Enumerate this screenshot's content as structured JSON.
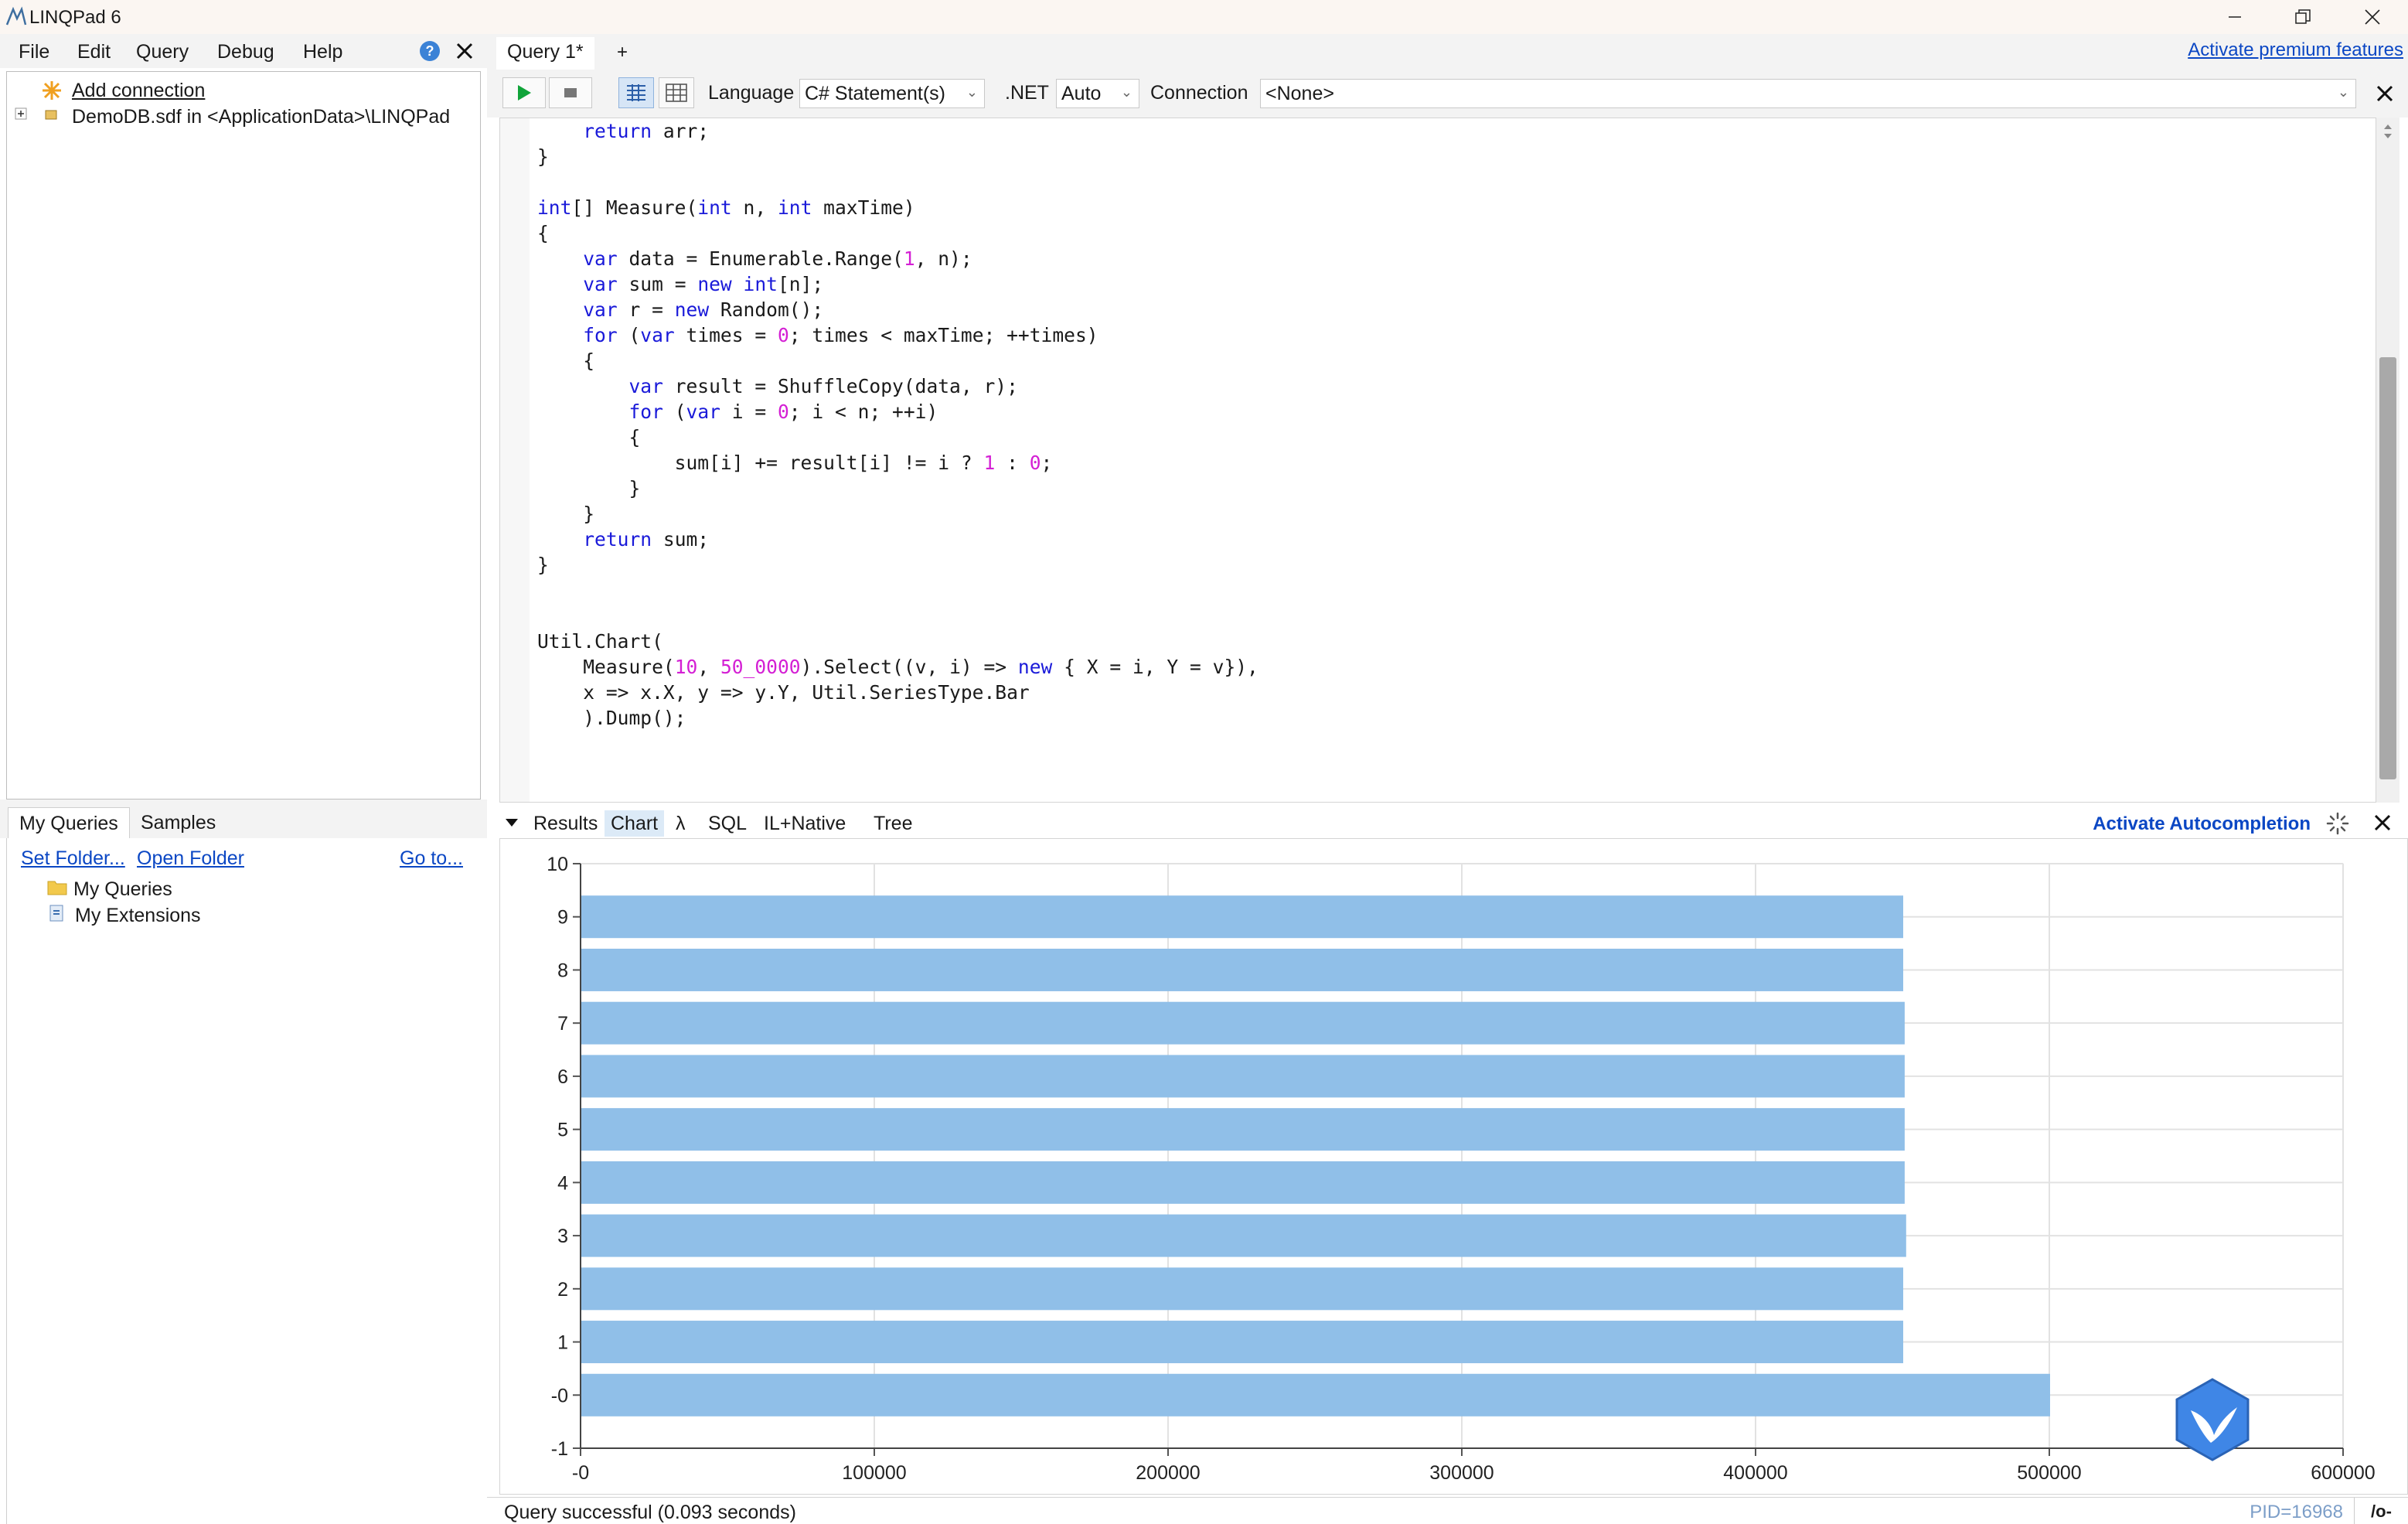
{
  "window": {
    "title": "LINQPad 6",
    "controls": [
      "minimize",
      "restore",
      "close"
    ]
  },
  "menu": {
    "items": [
      "File",
      "Edit",
      "Query",
      "Debug",
      "Help"
    ]
  },
  "connections": {
    "add_connection": "Add connection",
    "items": [
      "DemoDB.sdf in <ApplicationData>\\LINQPad"
    ]
  },
  "queries_panel": {
    "tabs": [
      "My Queries",
      "Samples"
    ],
    "set_folder": "Set Folder...",
    "open_folder": "Open Folder",
    "go_to": "Go to...",
    "tree": [
      "My Queries",
      "My Extensions"
    ]
  },
  "query_tabs": {
    "active": "Query 1*",
    "add": "+",
    "premium_link": "Activate premium features"
  },
  "toolbar": {
    "language_label": "Language",
    "language_value": "C# Statement(s)",
    "net_label": ".NET",
    "net_value": "Auto",
    "connection_label": "Connection",
    "connection_value": "<None>"
  },
  "results_bar": {
    "tabs": [
      "Results",
      "Chart",
      "λ",
      "SQL",
      "IL+Native",
      "Tree"
    ],
    "active_tab": "Chart",
    "autocompletion_link": "Activate Autocompletion"
  },
  "status": {
    "message": "Query successful  (0.093 seconds)",
    "pid": "PID=16968",
    "box": "/o-"
  },
  "colors": {
    "bar": "#90bfe8",
    "link": "#0b47c4",
    "keyword": "#1a1ad9",
    "number": "#d41fd4"
  },
  "chart_data": {
    "type": "bar",
    "orientation": "horizontal",
    "categories": [
      "-0",
      "1",
      "2",
      "3",
      "4",
      "5",
      "6",
      "7",
      "8",
      "9"
    ],
    "values": [
      500000,
      450000,
      450000,
      451000,
      450500,
      450500,
      450500,
      450500,
      450000,
      450000
    ],
    "xlim": [
      0,
      600000
    ],
    "ylim": [
      -1,
      10
    ],
    "x_ticks": [
      "-0",
      "100000",
      "200000",
      "300000",
      "400000",
      "500000",
      "600000"
    ],
    "y_ticks": [
      "-1",
      "-0",
      "1",
      "2",
      "3",
      "4",
      "5",
      "6",
      "7",
      "8",
      "9",
      "10"
    ],
    "grid": true
  }
}
